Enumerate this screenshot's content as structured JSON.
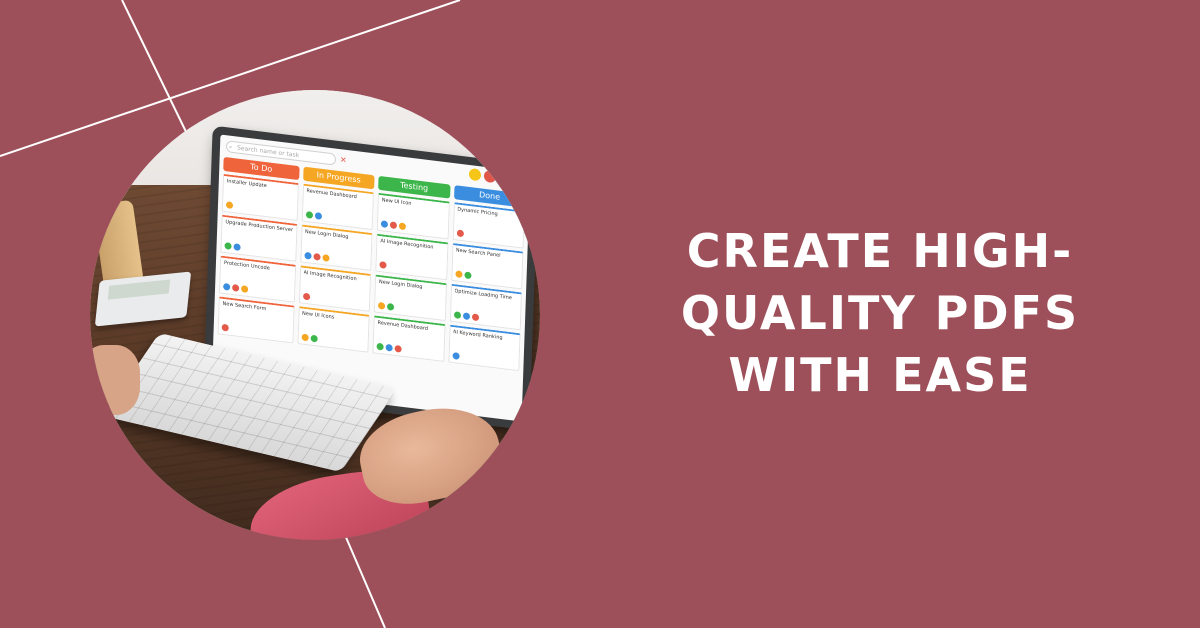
{
  "headline": {
    "lines": [
      "CREATE HIGH-",
      "QUALITY PDFS",
      "WITH EASE"
    ]
  },
  "photo": {
    "search_placeholder": "Search name or task",
    "columns": [
      {
        "label": "To Do",
        "color": "#f0643c",
        "cards": [
          "Installer Update",
          "Upgrade Production Server",
          "Protection Uncode",
          "New Search Form"
        ]
      },
      {
        "label": "In Progress",
        "color": "#f5a623",
        "cards": [
          "Revenue Dashboard",
          "New Login Dialog",
          "AI Image Recognition",
          "New UI Icons"
        ]
      },
      {
        "label": "Testing",
        "color": "#3cb64a",
        "cards": [
          "New UI Icon",
          "AI Image Recognition",
          "New Login Dialog",
          "Revenue Dashboard"
        ]
      },
      {
        "label": "Done",
        "color": "#3b8de0",
        "cards": [
          "Dynamic Pricing",
          "New Search Panel",
          "Optimize Loading Time",
          "AI Keyword Ranking"
        ]
      }
    ]
  },
  "colors": {
    "background": "#9e505a",
    "headline": "#ffffff",
    "lines": "#ffffff"
  }
}
